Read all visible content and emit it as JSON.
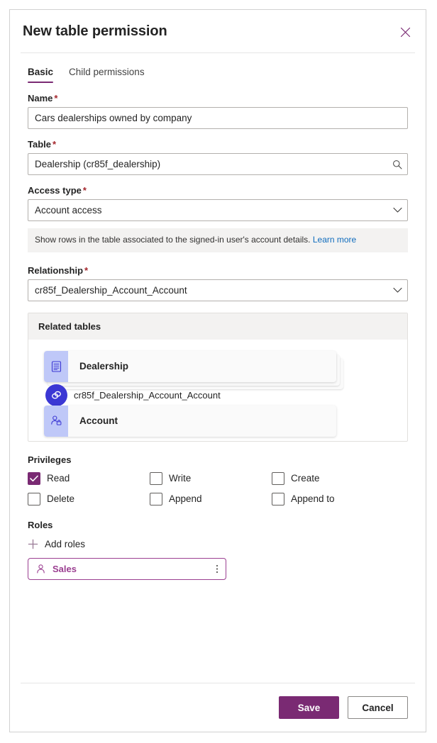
{
  "dialog": {
    "title": "New table permission",
    "close_icon": "close-icon"
  },
  "tabs": [
    {
      "label": "Basic",
      "active": true
    },
    {
      "label": "Child permissions",
      "active": false
    }
  ],
  "fields": {
    "name": {
      "label": "Name",
      "required": "*",
      "value": "Cars dealerships owned by company"
    },
    "table": {
      "label": "Table",
      "required": "*",
      "value": "Dealership (cr85f_dealership)",
      "affix_icon": "search-icon"
    },
    "access_type": {
      "label": "Access type",
      "required": "*",
      "value": "Account access",
      "affix_icon": "chevron-down-icon",
      "hint_text": "Show rows in the table associated to the signed-in user's account details.",
      "hint_link": "Learn more"
    },
    "relationship": {
      "label": "Relationship",
      "required": "*",
      "value": "cr85f_Dealership_Account_Account",
      "affix_icon": "chevron-down-icon"
    }
  },
  "related_tables": {
    "header": "Related tables",
    "source_node": {
      "label": "Dealership",
      "icon": "table-icon"
    },
    "relationship_node": {
      "label": "cr85f_Dealership_Account_Account",
      "icon": "link-icon"
    },
    "target_node": {
      "label": "Account",
      "icon": "account-contact-icon"
    }
  },
  "privileges": {
    "label": "Privileges",
    "items": [
      {
        "label": "Read",
        "checked": true
      },
      {
        "label": "Write",
        "checked": false
      },
      {
        "label": "Create",
        "checked": false
      },
      {
        "label": "Delete",
        "checked": false
      },
      {
        "label": "Append",
        "checked": false
      },
      {
        "label": "Append to",
        "checked": false
      }
    ]
  },
  "roles": {
    "label": "Roles",
    "add_label": "Add roles",
    "add_icon": "plus-icon",
    "chips": [
      {
        "name": "Sales",
        "icon": "person-icon",
        "more_icon": "more-vertical-icon"
      }
    ]
  },
  "footer": {
    "save_label": "Save",
    "cancel_label": "Cancel"
  },
  "colors": {
    "accent_purple": "#7a2a73",
    "chip_purple": "#9b3f91",
    "link_blue": "#0f6cbd",
    "required_red": "#a4262c",
    "node_icon_bg": "#bfc8f8",
    "relationship_bubble": "#3b37d4"
  }
}
